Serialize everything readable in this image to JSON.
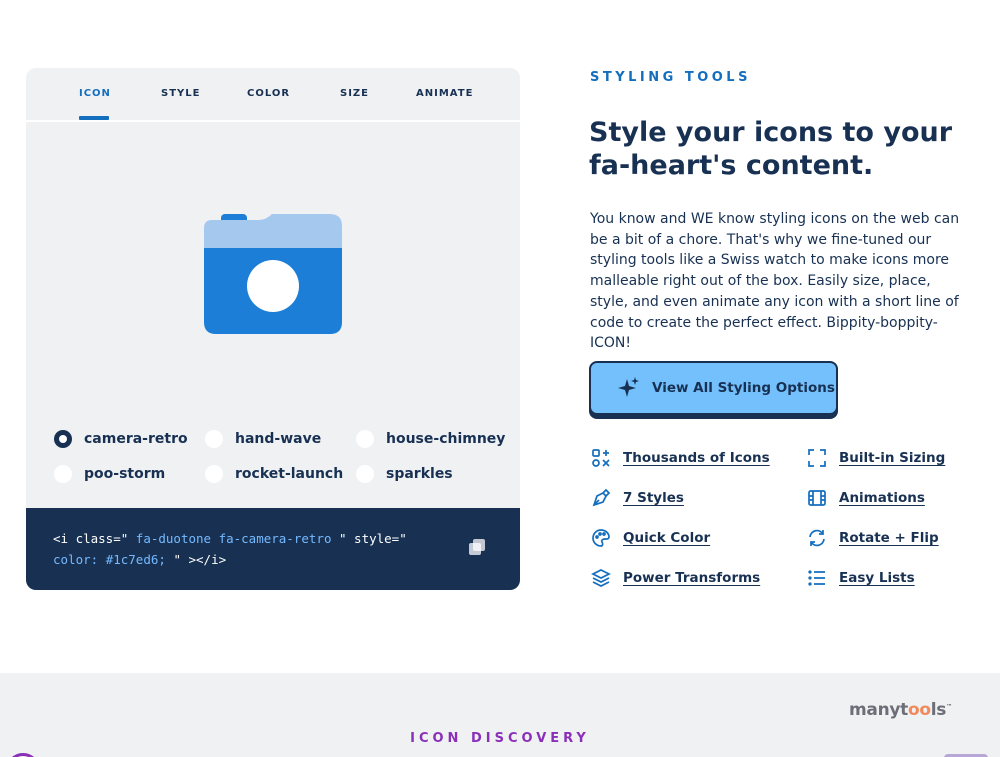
{
  "demo": {
    "tabs": [
      "ICON",
      "STYLE",
      "COLOR",
      "SIZE",
      "ANIMATE"
    ],
    "active_tab": "ICON",
    "icon_color": "#1c7ed6",
    "icon_secondary_color": "#a5c8ee",
    "options": [
      {
        "label": "camera-retro",
        "checked": true
      },
      {
        "label": "hand-wave",
        "checked": false
      },
      {
        "label": "house-chimney",
        "checked": false
      },
      {
        "label": "poo-storm",
        "checked": false
      },
      {
        "label": "rocket-launch",
        "checked": false
      },
      {
        "label": "sparkles",
        "checked": false
      }
    ],
    "code": {
      "p1": "<i class=\"",
      "p2": "fa-duotone fa-camera-retro",
      "p3": "\" style=\"",
      "p4": "color:",
      "p5": "#1c7ed6;",
      "p6": "\" ></i>"
    },
    "copy_icon": "copy-icon"
  },
  "section": {
    "eyebrow": "STYLING TOOLS",
    "title_line1": "Style your icons to your",
    "title_line2": "fa-heart's content.",
    "description": "You know and WE know styling icons on the web can be a bit of a chore. That's why we fine-tuned our styling tools like a Swiss watch to make icons more malleable right out of the box. Easily size, place, style, and even animate any icon with a short line of code to create the perfect effect. Bippity-boppity-ICON!",
    "cta_label": "View All Styling Options",
    "cta_icon": "sparkles-icon",
    "features": [
      {
        "label": "Thousands of Icons",
        "icon": "icons-icon"
      },
      {
        "label": "Built-in Sizing",
        "icon": "expand-icon"
      },
      {
        "label": "7 Styles",
        "icon": "pen-nib-icon"
      },
      {
        "label": "Animations",
        "icon": "film-icon"
      },
      {
        "label": "Quick Color",
        "icon": "palette-icon"
      },
      {
        "label": "Rotate + Flip",
        "icon": "rotate-icon"
      },
      {
        "label": "Power Transforms",
        "icon": "layer-group-icon"
      },
      {
        "label": "Easy Lists",
        "icon": "list-icon"
      }
    ]
  },
  "footer": {
    "eyebrow": "ICON DISCOVERY",
    "watermark": {
      "part1": "manyt",
      "part2": "oo",
      "part3": "ls",
      "tm": "™"
    }
  },
  "colors": {
    "accent_blue": "#146ebe",
    "navy": "#183153",
    "cta_bg": "#74c0fc",
    "discovery_purple": "#8a2fb8"
  }
}
